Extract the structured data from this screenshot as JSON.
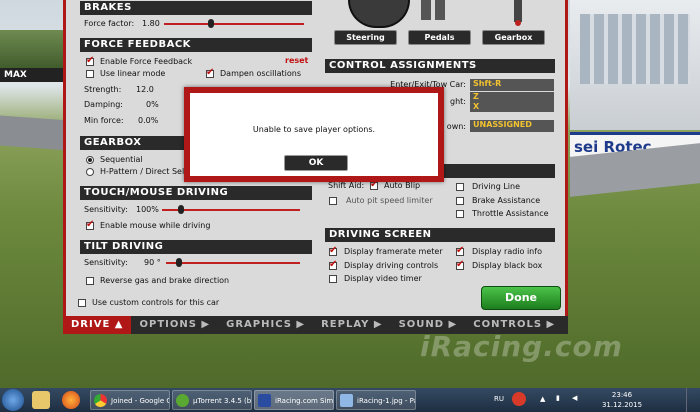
{
  "background": {
    "left_sign": "MAX",
    "right_sign": "sei Rotec",
    "watermark": "iRacing.com"
  },
  "brakes": {
    "title": "BRAKES",
    "force_factor_label": "Force factor:",
    "force_factor_value": "1.80",
    "force_factor_level": 0.33
  },
  "force_feedback": {
    "title": "FORCE FEEDBACK",
    "enable_label": "Enable Force Feedback",
    "enable_checked": true,
    "reset_label": "reset",
    "linear_label": "Use linear mode",
    "linear_checked": false,
    "dampen_label": "Dampen oscillations",
    "dampen_checked": true,
    "strength_label": "Strength:",
    "strength_value": "12.0",
    "damping_label": "Damping:",
    "damping_value": "0%",
    "min_force_label": "Min force:",
    "min_force_value": "0.0%"
  },
  "gearbox": {
    "title": "GEARBOX",
    "sequential_label": "Sequential",
    "h_pattern_label": "H-Pattern / Direct Sele",
    "selected": "sequential"
  },
  "touch_mouse": {
    "title": "TOUCH/MOUSE DRIVING",
    "sensitivity_label": "Sensitivity:",
    "sensitivity_value": "100%",
    "sensitivity_level": 0.12,
    "enable_mouse_label": "Enable mouse while driving",
    "enable_mouse_checked": true
  },
  "tilt": {
    "title": "TILT DRIVING",
    "sensitivity_label": "Sensitivity:",
    "sensitivity_value": "90 °",
    "sensitivity_level": 0.08,
    "reverse_label": "Reverse gas and brake direction",
    "reverse_checked": false
  },
  "custom_controls": {
    "label": "Use custom controls for this car",
    "checked": false
  },
  "controllers": {
    "steering": "Steering",
    "pedals": "Pedals",
    "gearbox": "Gearbox"
  },
  "control_assignments": {
    "title": "CONTROL ASSIGNMENTS",
    "rows": [
      {
        "label": "Enter/Exit/Tow Car:",
        "value": "Shft-R"
      },
      {
        "label": "ght:",
        "value": "Z"
      },
      {
        "label": "",
        "value": "X"
      },
      {
        "label": "own:",
        "value": "UNASSIGNED"
      }
    ]
  },
  "driving_aids": {
    "shift_aid_label": "Shift Aid:",
    "auto_blip_label": "Auto Blip",
    "auto_blip_checked": true,
    "auto_pit_label": "Auto pit speed limiter",
    "auto_pit_checked": false,
    "driving_line_label": "Driving Line",
    "driving_line_checked": false,
    "brake_assist_label": "Brake Assistance",
    "brake_assist_checked": false,
    "throttle_assist_label": "Throttle Assistance",
    "throttle_assist_checked": false
  },
  "driving_screen": {
    "title": "DRIVING SCREEN",
    "framerate_label": "Display framerate meter",
    "framerate_checked": true,
    "controls_label": "Display driving controls",
    "controls_checked": true,
    "video_timer_label": "Display video timer",
    "video_timer_checked": false,
    "radio_label": "Display radio info",
    "radio_checked": true,
    "black_box_label": "Display black box",
    "black_box_checked": true
  },
  "done_label": "Done",
  "nav": {
    "drive": "DRIVE",
    "options": "OPTIONS",
    "graphics": "GRAPHICS",
    "replay": "REPLAY",
    "sound": "SOUND",
    "controls": "CONTROLS",
    "active": "drive"
  },
  "dialog": {
    "message": "Unable to save player options.",
    "ok_label": "OK"
  },
  "taskbar": {
    "tasks": [
      "Joined - Google C...",
      "µTorrent 3.4.5 (b...",
      "iRacing.com Sim...",
      "iRacing-1.jpg - Pa..."
    ],
    "language": "RU",
    "time": "23:46",
    "date": "31.12.2015"
  },
  "colors": {
    "accent_red": "#b01818",
    "section_dark": "#2a2a2a",
    "assign_yellow": "#f2c230",
    "done_green": "#2c9a2a"
  }
}
